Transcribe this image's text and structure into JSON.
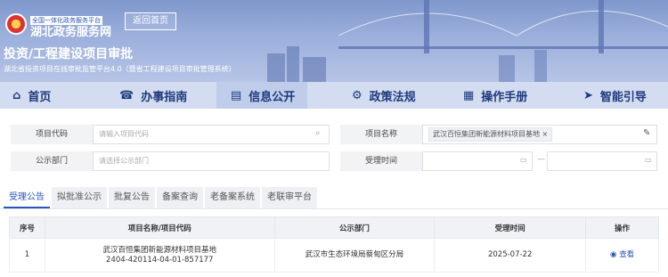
{
  "header": {
    "logo_sub": "全国一体化政务服务平台",
    "logo_main": "湖北政务服务网",
    "back_label": "返回首页",
    "title": "投资/工程建设项目审批",
    "subtitle": "湖北省投资项目在线审批监管平台4.0（暨省工程建设项目审批管理系统）"
  },
  "nav": {
    "items": [
      {
        "label": "首页",
        "icon": "home-icon"
      },
      {
        "label": "办事指南",
        "icon": "headset-icon"
      },
      {
        "label": "信息公开",
        "icon": "folder-icon"
      },
      {
        "label": "政策法规",
        "icon": "gear-icon"
      },
      {
        "label": "操作手册",
        "icon": "document-icon"
      },
      {
        "label": "智能引导",
        "icon": "navigation-icon"
      }
    ]
  },
  "filters": {
    "code_label": "项目代码",
    "code_placeholder": "请输入项目代码",
    "name_label": "项目名称",
    "name_value": "武汉百恒集团新能源材料项目基地",
    "dept_label": "公示部门",
    "dept_placeholder": "请选择公示部门",
    "time_label": "受理时间",
    "time_sep": "—"
  },
  "tabs": [
    "受理公告",
    "拟批准公示",
    "批复公告",
    "备案查询",
    "老备案系统",
    "老联审平台"
  ],
  "table": {
    "headers": [
      "序号",
      "项目名称/项目代码",
      "公示部门",
      "受理时间",
      "操作"
    ],
    "rows": [
      {
        "index": "1",
        "name": "武汉百恒集团新能源材料项目基地",
        "code": "2404-420114-04-01-857177",
        "dept": "武汉市生态环境局蔡甸区分局",
        "time": "2025-07-22",
        "action": "查看"
      }
    ]
  },
  "colors": {
    "accent": "#2a56b7",
    "nav_bg": "#d3dcf1"
  }
}
